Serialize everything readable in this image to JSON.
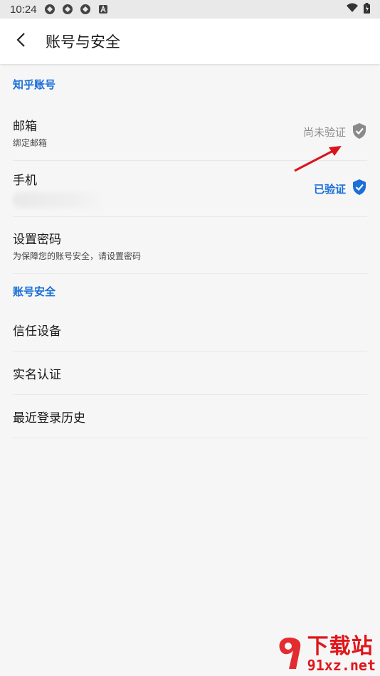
{
  "status_bar": {
    "time": "10:24",
    "icons": [
      "sync-icon",
      "sync-icon",
      "sync-icon",
      "a-icon"
    ],
    "right_icons": [
      "wifi-icon",
      "battery-icon"
    ]
  },
  "app_bar": {
    "title": "账号与安全",
    "back_icon": "chevron-left-icon"
  },
  "sections": {
    "account": {
      "header": "知乎账号",
      "email": {
        "title": "邮箱",
        "subtitle": "绑定邮箱",
        "status": "尚未验证"
      },
      "phone": {
        "title": "手机",
        "status": "已验证"
      },
      "password": {
        "title": "设置密码",
        "subtitle": "为保障您的账号安全，请设置密码"
      }
    },
    "security": {
      "header": "账号安全",
      "items": [
        "信任设备",
        "实名认证",
        "最近登录历史"
      ]
    }
  },
  "watermark": {
    "top": "下载站",
    "bottom": "91xz.net"
  },
  "colors": {
    "accent": "#1a6fd8",
    "unverified": "#8a8a8a",
    "annotation_arrow": "#d8161b",
    "watermark": "#e0161b"
  }
}
